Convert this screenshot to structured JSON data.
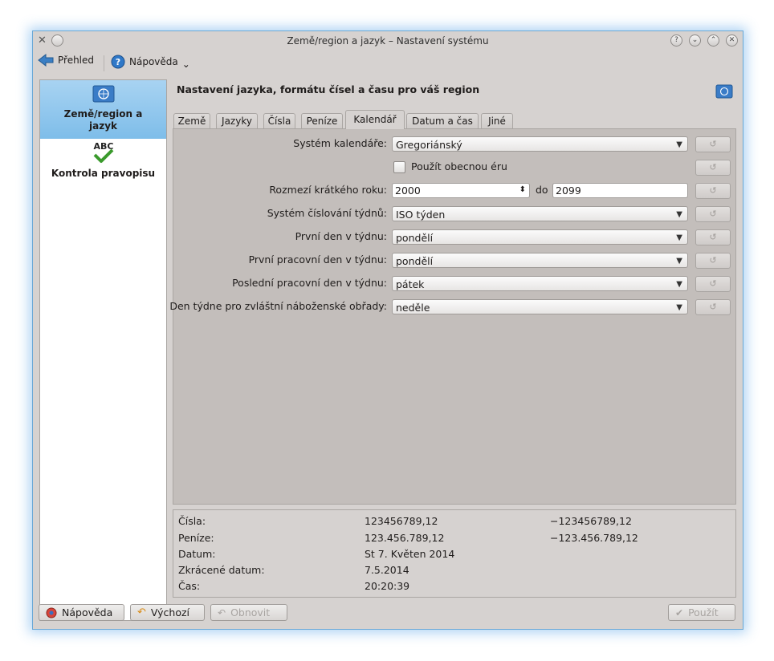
{
  "window": {
    "title": "Země/region a jazyk – Nastavení systému"
  },
  "toolbar": {
    "overview_label": "Přehled",
    "help_label": "Nápověda",
    "help_menu_arrow": "⌄"
  },
  "sidebar": {
    "items": [
      {
        "label": "Země/region a jazyk",
        "icon": "un-flag-icon",
        "selected": true
      },
      {
        "label": "Kontrola pravopisu",
        "icon": "spellcheck-icon",
        "selected": false,
        "icon_text": "ABC"
      }
    ]
  },
  "header": {
    "title": "Nastavení jazyka, formátu čísel a času pro váš region"
  },
  "tabs": [
    {
      "label": "Země",
      "active": false
    },
    {
      "label": "Jazyky",
      "active": false
    },
    {
      "label": "Čísla",
      "active": false
    },
    {
      "label": "Peníze",
      "active": false
    },
    {
      "label": "Kalendář",
      "active": true
    },
    {
      "label": "Datum a čas",
      "active": false
    },
    {
      "label": "Jiné",
      "active": false
    }
  ],
  "calendar": {
    "system_label": "Systém kalendáře:",
    "system_value": "Gregoriánský",
    "common_era_label": "Použít obecnou éru",
    "common_era_checked": false,
    "short_year_label": "Rozmezí krátkého roku:",
    "short_year_from": "2000",
    "short_year_to_label": "do",
    "short_year_to": "2099",
    "week_numbering_label": "Systém číslování týdnů:",
    "week_numbering_value": "ISO týden",
    "first_day_label": "První den v týdnu:",
    "first_day_value": "pondělí",
    "first_work_day_label": "První pracovní den v týdnu:",
    "first_work_day_value": "pondělí",
    "last_work_day_label": "Poslední pracovní den v týdnu:",
    "last_work_day_value": "pátek",
    "religious_day_label": "Den týdne pro zvláštní náboženské obřady:",
    "religious_day_value": "neděle"
  },
  "preview": {
    "rows": [
      {
        "label": "Čísla:",
        "positive": "123456789,12",
        "negative": "−123456789,12"
      },
      {
        "label": "Peníze:",
        "positive": "123.456.789,12",
        "negative": "−123.456.789,12"
      },
      {
        "label": "Datum:",
        "positive": "St 7. Květen 2014",
        "negative": ""
      },
      {
        "label": "Zkrácené datum:",
        "positive": "7.5.2014",
        "negative": ""
      },
      {
        "label": "Čas:",
        "positive": "20:20:39",
        "negative": ""
      }
    ]
  },
  "buttons": {
    "help": "Nápověda",
    "defaults": "Výchozí",
    "reset": "Obnovit",
    "apply": "Použít"
  },
  "colors": {
    "selection": "#7ebde9",
    "window_bg": "#d6d2d0",
    "panel_bg": "#c3bebb",
    "window_glow": "#50a0e6"
  }
}
